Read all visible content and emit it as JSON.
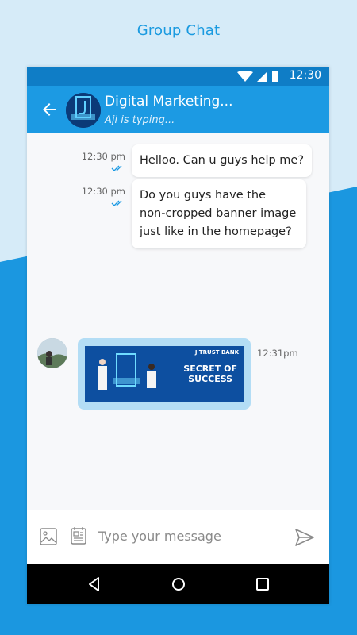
{
  "page_heading": "Group Chat",
  "status_bar": {
    "time": "12:30"
  },
  "header": {
    "title": "Digital Marketing...",
    "subtitle": "Aji is typing..."
  },
  "messages": [
    {
      "time": "12:30 pm",
      "text": "Helloo. Can u guys help me?"
    },
    {
      "time": "12:30 pm",
      "lines": [
        "Do you guys have the",
        "non-cropped banner image",
        "just like in the homepage?"
      ]
    },
    {
      "time": "12:31pm",
      "banner": {
        "brand": "J TRUST BANK",
        "headline": [
          "SECRET OF",
          "SUCCESS"
        ]
      }
    }
  ],
  "composer": {
    "placeholder": "Type your message"
  },
  "colors": {
    "app_bar": "#1c9ae3",
    "status_bar": "#0f7dc6",
    "accent": "#1a9ae0"
  }
}
